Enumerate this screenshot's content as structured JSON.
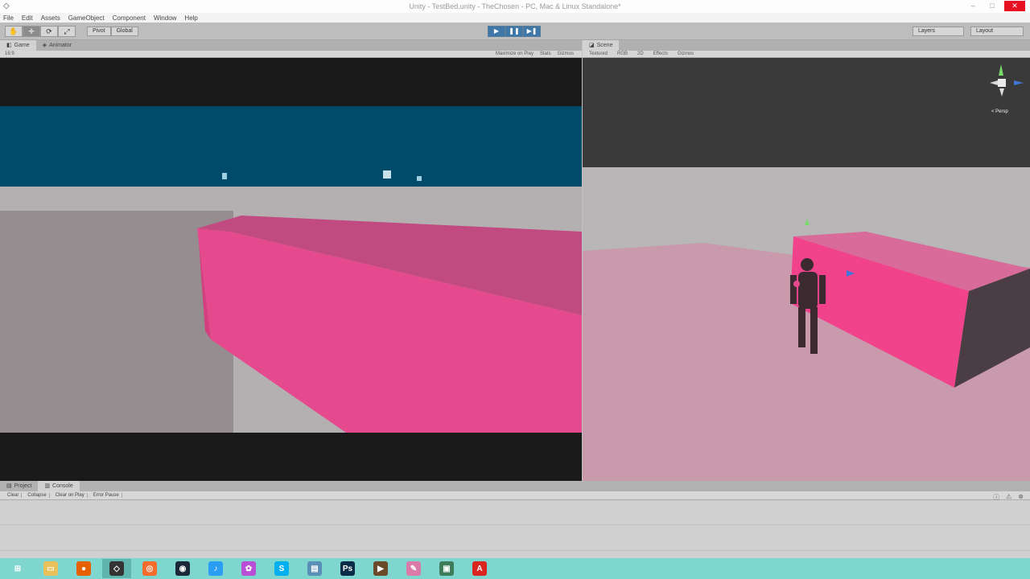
{
  "window": {
    "title": "Unity - TestBed.unity - TheChosen - PC, Mac & Linux Standalone*",
    "minimize": "–",
    "maximize": "□",
    "close": "✕"
  },
  "menu": [
    "File",
    "Edit",
    "Assets",
    "GameObject",
    "Component",
    "Window",
    "Help"
  ],
  "toolbar": {
    "pivot_label": "Pivot",
    "global_label": "Global",
    "play_label": "▶",
    "pause_label": "❚❚",
    "step_label": "▶❚",
    "layers_label": "Layers",
    "layout_label": "Layout"
  },
  "game_panel": {
    "tabs": [
      {
        "label": "Game",
        "icon": "gamepad-icon",
        "active": true
      },
      {
        "label": "Animator",
        "icon": "animator-icon",
        "active": false
      }
    ],
    "aspect": "16:9",
    "options": [
      "Maximize on Play",
      "Stats",
      "Gizmos"
    ]
  },
  "scene_panel": {
    "tab": "Scene",
    "toolbar": [
      "Textured",
      "RGB",
      "2D",
      "Effects",
      "Gizmos"
    ],
    "persp_label": "< Persp"
  },
  "console_panel": {
    "tabs": [
      {
        "label": "Project",
        "active": false
      },
      {
        "label": "Console",
        "active": true
      }
    ],
    "buttons": [
      "Clear",
      "Collapse",
      "Clear on Play",
      "Error Pause"
    ]
  },
  "taskbar": {
    "items": [
      {
        "name": "windows-start-icon",
        "color": "#ffffff",
        "glyph": "⊞"
      },
      {
        "name": "file-explorer-icon",
        "color": "#e8c15a",
        "glyph": "▭"
      },
      {
        "name": "firefox-icon",
        "color": "#e66000",
        "glyph": "●"
      },
      {
        "name": "unity-icon",
        "color": "#333333",
        "glyph": "◇"
      },
      {
        "name": "origin-icon",
        "color": "#f56c2d",
        "glyph": "◎"
      },
      {
        "name": "steam-icon",
        "color": "#1b2838",
        "glyph": "◉"
      },
      {
        "name": "itunes-icon",
        "color": "#2a9df4",
        "glyph": "♪"
      },
      {
        "name": "picasa-icon",
        "color": "#b84fd6",
        "glyph": "✿"
      },
      {
        "name": "skype-icon",
        "color": "#00aff0",
        "glyph": "S"
      },
      {
        "name": "notepad-icon",
        "color": "#5a8fb8",
        "glyph": "▤"
      },
      {
        "name": "photoshop-icon",
        "color": "#0b2c47",
        "glyph": "Ps"
      },
      {
        "name": "media-icon",
        "color": "#6b4a2a",
        "glyph": "▶"
      },
      {
        "name": "paint-icon",
        "color": "#d97aa8",
        "glyph": "✎"
      },
      {
        "name": "screen-recorder-icon",
        "color": "#3e7d5a",
        "glyph": "▣"
      },
      {
        "name": "acrobat-icon",
        "color": "#d9241f",
        "glyph": "A"
      }
    ]
  },
  "colors": {
    "sky": "#004a6a",
    "letterbox": "#1a1a1a",
    "pink_block": "#e54a8e",
    "floor_grey": "#a8a2a6"
  }
}
